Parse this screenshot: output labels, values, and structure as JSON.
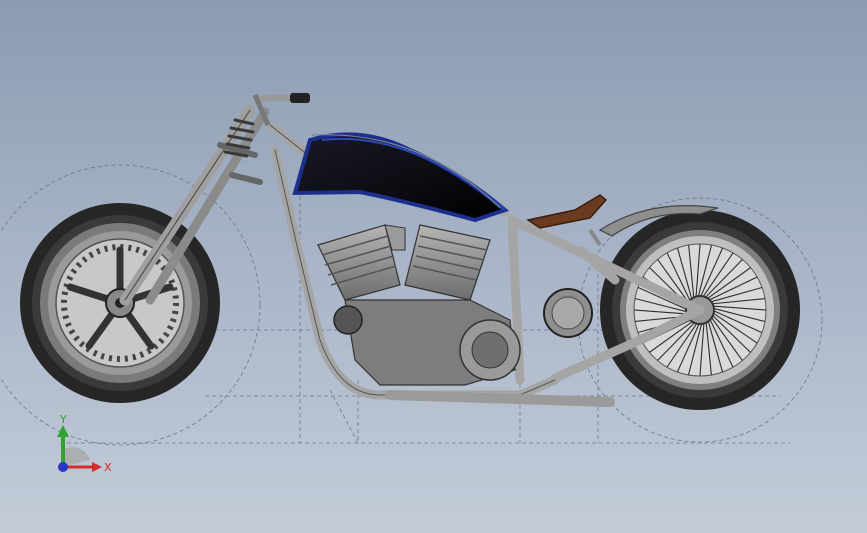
{
  "scene": {
    "object": "bobber-motorcycle-assembly",
    "colors": {
      "background_top": "#8b9bb2",
      "background_bottom": "#c3ccd8",
      "frame": "#a9a9a9",
      "tank_body": "#0a0a14",
      "tank_trim": "#1c2f8c",
      "seat": "#6b3a1f",
      "tire": "#2a2a2a",
      "engine": "#8c8c8c"
    }
  },
  "triad": {
    "x_label": "X",
    "y_label": "Y",
    "x_color": "#d42b2b",
    "y_color": "#2fa52f",
    "z_color": "#2b35c8"
  }
}
